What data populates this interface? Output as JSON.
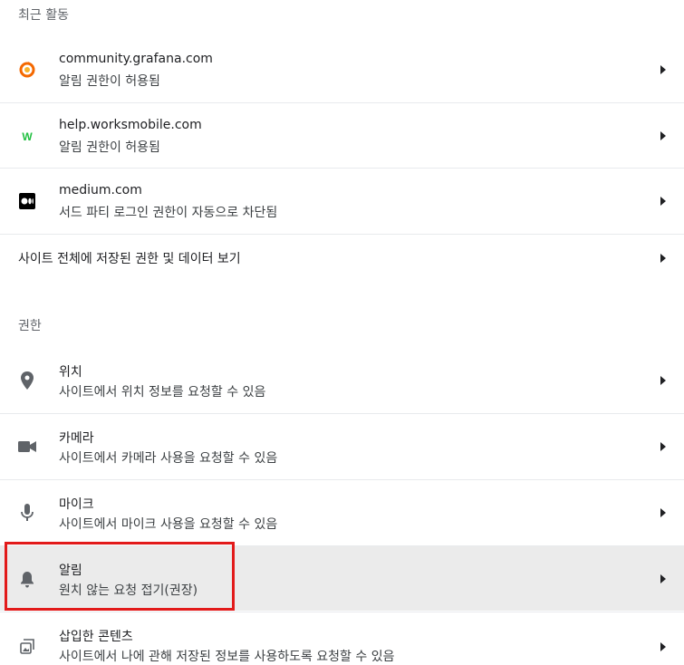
{
  "recent": {
    "title": "최근 활동",
    "items": [
      {
        "site": "community.grafana.com",
        "status": "알림 권한이 허용됨",
        "icon": "grafana-favicon-icon"
      },
      {
        "site": "help.worksmobile.com",
        "status": "알림 권한이 허용됨",
        "icon": "worksmobile-favicon-icon"
      },
      {
        "site": "medium.com",
        "status": "서드 파티 로그인 권한이 자동으로 차단됨",
        "icon": "medium-favicon-icon"
      }
    ],
    "view_all": "사이트 전체에 저장된 권한 및 데이터 보기"
  },
  "permissions": {
    "title": "권한",
    "items": [
      {
        "label": "위치",
        "desc": "사이트에서 위치 정보를 요청할 수 있음",
        "icon": "location-pin-icon"
      },
      {
        "label": "카메라",
        "desc": "사이트에서 카메라 사용을 요청할 수 있음",
        "icon": "camera-icon"
      },
      {
        "label": "마이크",
        "desc": "사이트에서 마이크 사용을 요청할 수 있음",
        "icon": "microphone-icon"
      },
      {
        "label": "알림",
        "desc": "원치 않는 요청 접기(권장)",
        "icon": "bell-icon"
      },
      {
        "label": "삽입한 콘텐츠",
        "desc": "사이트에서 나에 관해 저장된 정보를 사용하도록 요청할 수 있음",
        "icon": "embedded-content-icon"
      }
    ]
  },
  "colors": {
    "highlight_bg": "#ebebeb",
    "annotation_red": "#e21a1a",
    "icon_gray": "#5f6368"
  }
}
